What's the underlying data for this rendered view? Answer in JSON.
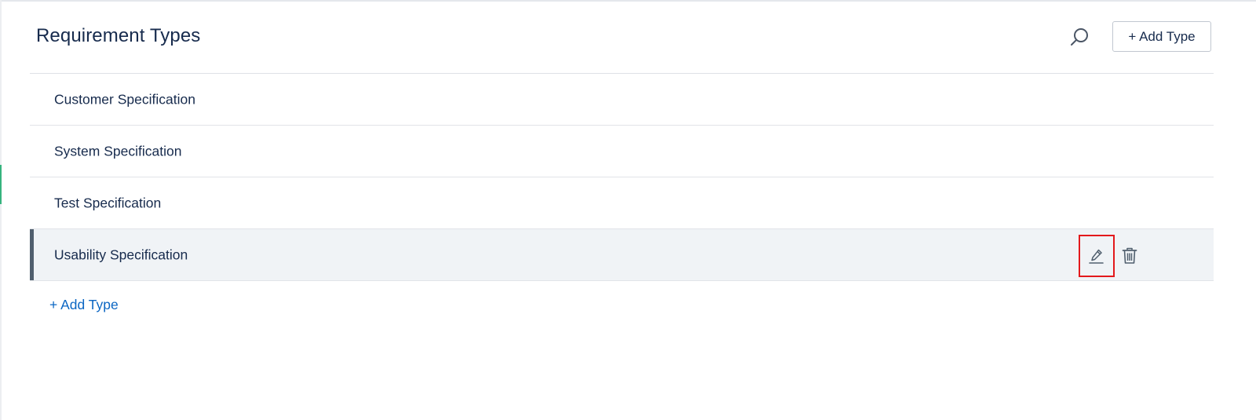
{
  "header": {
    "title": "Requirement Types",
    "add_type_label": "+ Add Type"
  },
  "icons": {
    "search": "search-icon",
    "edit": "pencil-icon",
    "delete": "trash-icon"
  },
  "requirement_types": [
    {
      "label": "Customer Specification",
      "selected": false
    },
    {
      "label": "System Specification",
      "selected": false
    },
    {
      "label": "Test Specification",
      "selected": false
    },
    {
      "label": "Usability Specification",
      "selected": true
    }
  ],
  "footer": {
    "add_type_label": "+ Add Type"
  },
  "colors": {
    "text": "#172b4d",
    "link": "#0b66c3",
    "selected_row_bg": "#f0f3f6",
    "selected_bar": "#505f6e",
    "highlight_box": "#e3191c",
    "accent": "#36b37e"
  }
}
